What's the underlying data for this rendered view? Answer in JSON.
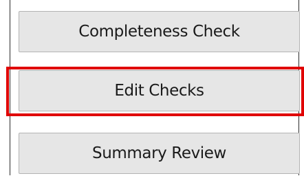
{
  "buttons": {
    "completeness_check": "Completeness Check",
    "edit_checks": "Edit Checks",
    "summary_review": "Summary Review"
  },
  "highlight": {
    "target": "edit_checks",
    "color": "#e00000"
  }
}
